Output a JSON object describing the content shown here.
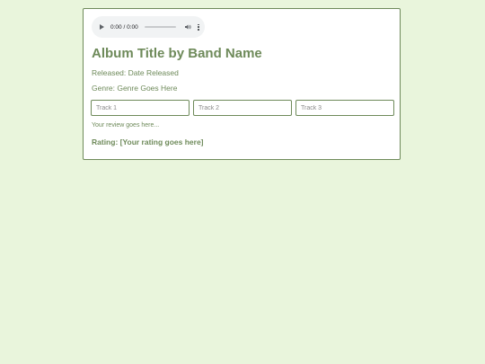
{
  "audio_player": {
    "time_display": "0:00 / 0:00",
    "icons": [
      "play-icon",
      "volume-icon",
      "more-options-icon"
    ]
  },
  "album": {
    "title": "Album Title by Band Name",
    "released": "Released: Date Released",
    "genre": "Genre: Genre Goes Here"
  },
  "tracks": [
    {
      "placeholder": "Track 1"
    },
    {
      "placeholder": "Track 2"
    },
    {
      "placeholder": "Track 3"
    }
  ],
  "review": "Your review goes here...",
  "rating": "Rating: [Your rating goes here]",
  "colors": {
    "background": "#e9f5dc",
    "accent": "#6e8a5a",
    "card": "#ffffff"
  }
}
